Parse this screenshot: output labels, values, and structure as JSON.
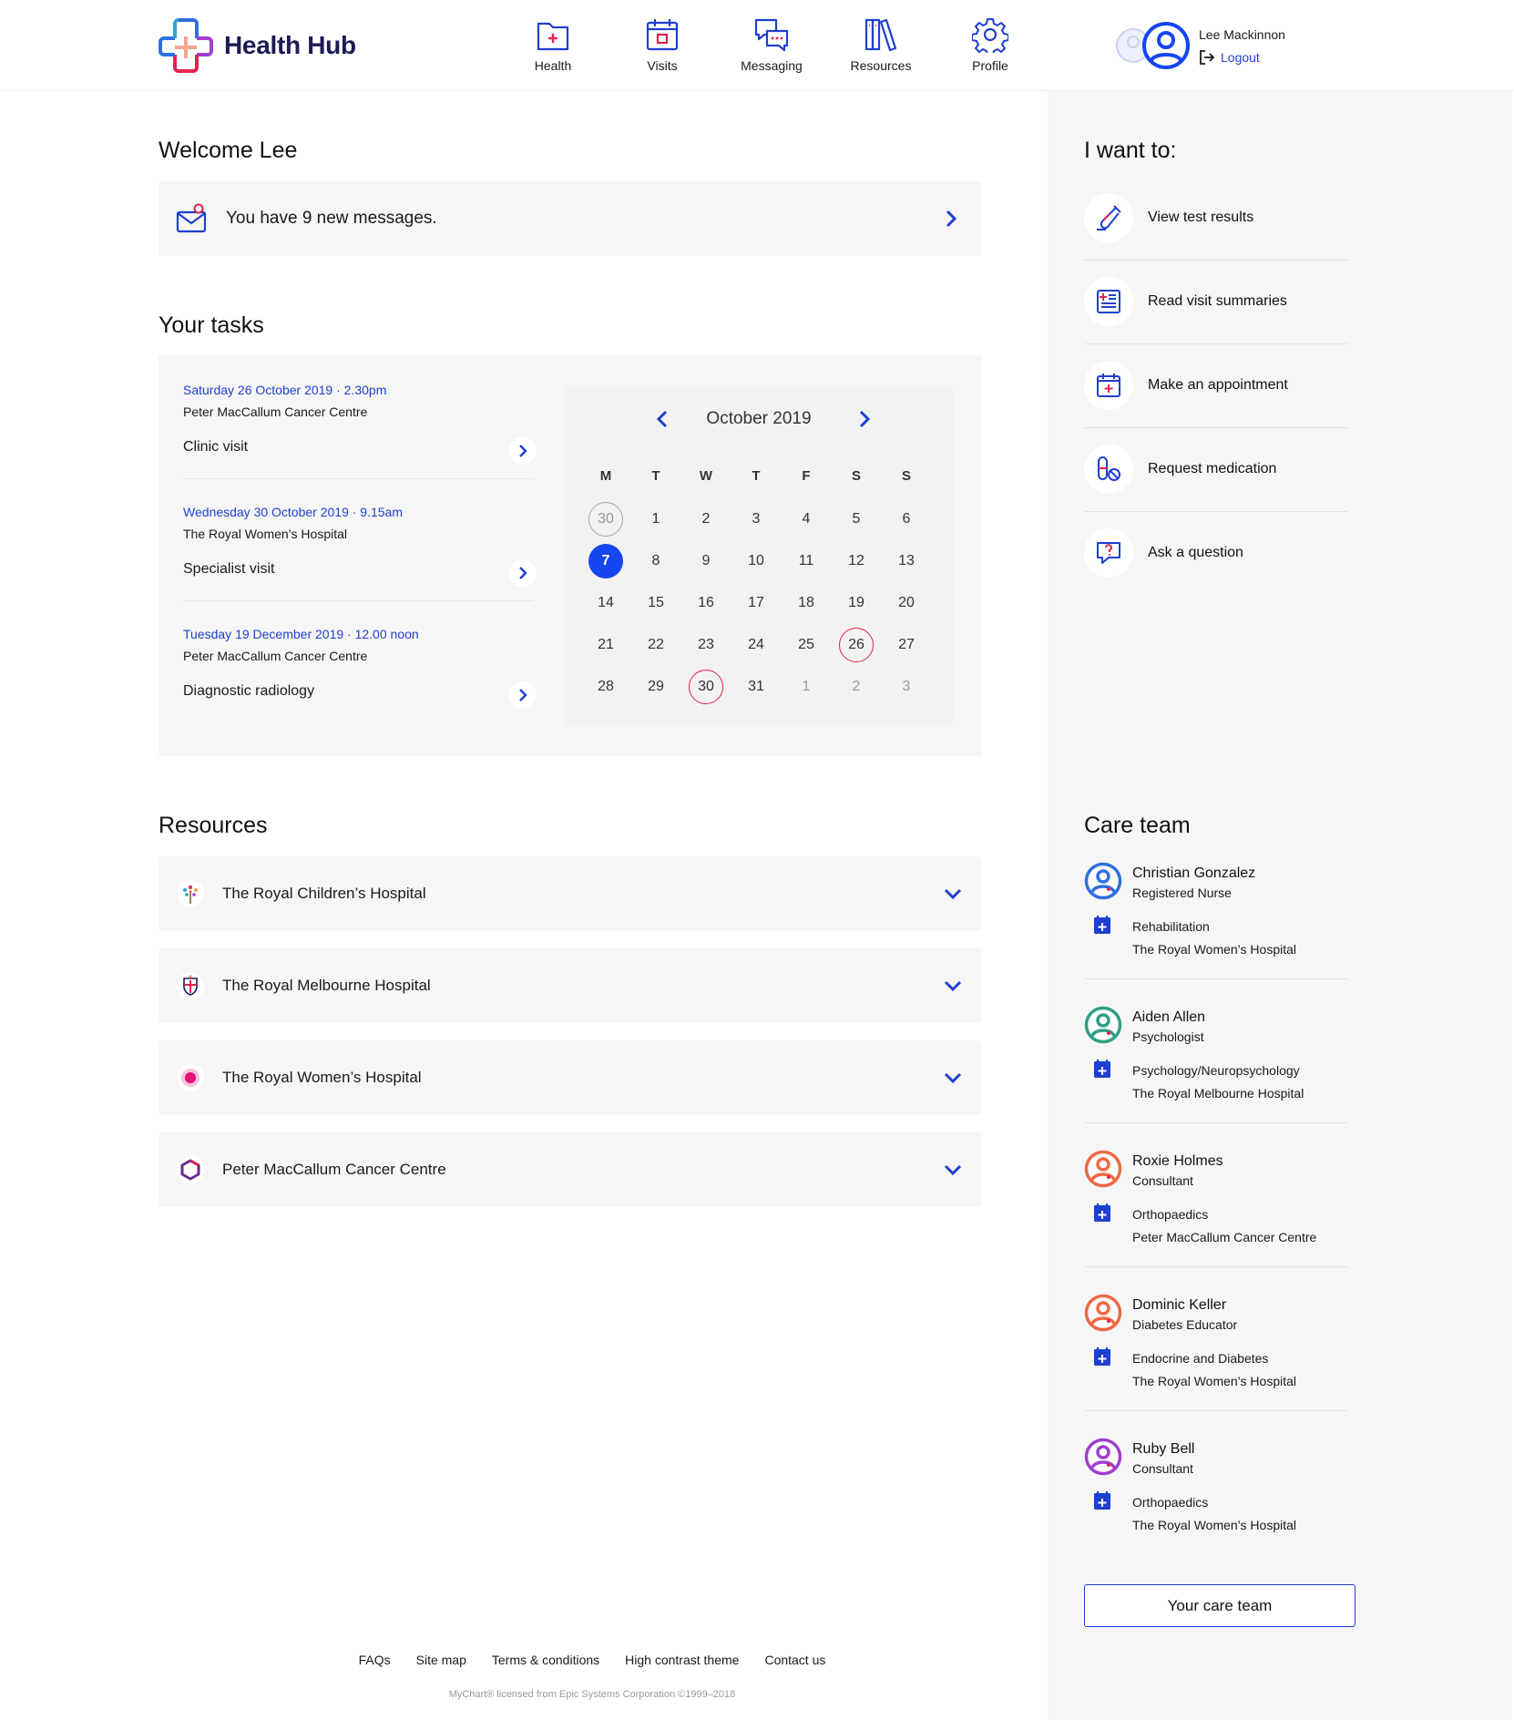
{
  "header": {
    "logo_text": "Health Hub",
    "nav": [
      {
        "label": "Health",
        "icon": "health-folder-icon"
      },
      {
        "label": "Visits",
        "icon": "calendar-icon"
      },
      {
        "label": "Messaging",
        "icon": "chat-bubbles-icon"
      },
      {
        "label": "Resources",
        "icon": "books-icon"
      },
      {
        "label": "Profile",
        "icon": "gear-icon"
      }
    ],
    "user_name": "Lee Mackinnon",
    "logout_label": "Logout"
  },
  "welcome": {
    "title": "Welcome Lee",
    "message_text": "You have 9 new messages."
  },
  "tasks": {
    "title": "Your tasks",
    "items": [
      {
        "date": "Saturday 26 October 2019 · 2.30pm",
        "place": "Peter MacCallum Cancer Centre",
        "type": "Clinic visit"
      },
      {
        "date": "Wednesday 30 October 2019 · 9.15am",
        "place": "The Royal Women’s Hospital",
        "type": "Specialist visit"
      },
      {
        "date": "Tuesday 19 December 2019 · 12.00 noon",
        "place": "Peter MacCallum Cancer Centre",
        "type": "Diagnostic radiology"
      }
    ],
    "calendar": {
      "month_label": "October 2019",
      "weekdays": [
        "M",
        "T",
        "W",
        "T",
        "F",
        "S",
        "S"
      ],
      "weeks": [
        [
          "30",
          "1",
          "2",
          "3",
          "4",
          "5",
          "6"
        ],
        [
          "7",
          "8",
          "9",
          "10",
          "11",
          "12",
          "13"
        ],
        [
          "14",
          "15",
          "16",
          "17",
          "18",
          "19",
          "20"
        ],
        [
          "21",
          "22",
          "23",
          "24",
          "25",
          "26",
          "27"
        ],
        [
          "28",
          "29",
          "30",
          "31",
          "1",
          "2",
          "3"
        ]
      ],
      "today": "7",
      "appointment_days": [
        "26",
        "30"
      ],
      "colors": {
        "today": "#1546f0",
        "appointment_ring": "#e0244f",
        "outside_month": "#9a9a9a"
      }
    }
  },
  "resources": {
    "title": "Resources",
    "items": [
      {
        "label": "The Royal Children’s Hospital",
        "icon": "tree-logo-icon"
      },
      {
        "label": "The Royal Melbourne Hospital",
        "icon": "crest-logo-icon"
      },
      {
        "label": "The Royal Women’s Hospital",
        "icon": "pink-flower-logo-icon"
      },
      {
        "label": "Peter MacCallum Cancer Centre",
        "icon": "purple-ring-logo-icon"
      }
    ]
  },
  "want": {
    "title": "I want to:",
    "items": [
      {
        "label": "View test results",
        "icon": "test-tube-icon"
      },
      {
        "label": "Read visit summaries",
        "icon": "document-list-icon"
      },
      {
        "label": "Make an appointment",
        "icon": "calendar-plus-icon"
      },
      {
        "label": "Request medication",
        "icon": "pill-icon"
      },
      {
        "label": "Ask a question",
        "icon": "question-bubble-icon"
      }
    ]
  },
  "care_team": {
    "title": "Care team",
    "members": [
      {
        "name": "Christian Gonzalez",
        "role": "Registered Nurse",
        "department": "Rehabilitation",
        "hospital": "The Royal Women’s Hospital",
        "color": "#2f6fe0"
      },
      {
        "name": "Aiden Allen",
        "role": "Psychologist",
        "department": "Psychology/Neuropsychology",
        "hospital": "The Royal Melbourne Hospital",
        "color": "#2f9f86"
      },
      {
        "name": "Roxie Holmes",
        "role": "Consultant",
        "department": "Orthopaedics",
        "hospital": "Peter MacCallum Cancer Centre",
        "color": "#ee6a45"
      },
      {
        "name": "Dominic Keller",
        "role": "Diabetes Educator",
        "department": "Endocrine and Diabetes",
        "hospital": "The Royal Women’s Hospital",
        "color": "#ee6a45"
      },
      {
        "name": "Ruby Bell",
        "role": "Consultant",
        "department": "Orthopaedics",
        "hospital": "The Royal Women’s Hospital",
        "color": "#a03fd1"
      }
    ],
    "button_label": "Your care team"
  },
  "footer": {
    "links": [
      "FAQs",
      "Site map",
      "Terms & conditions",
      "High contrast theme",
      "Contact us"
    ],
    "copyright": "MyChart® licensed from Epic Systems Corporation ©1999–2018"
  },
  "colors": {
    "accent": "#1f3fd1",
    "brand_navy": "#1d1a55",
    "pink": "#e0244f",
    "card_bg": "#f6f6f6"
  }
}
